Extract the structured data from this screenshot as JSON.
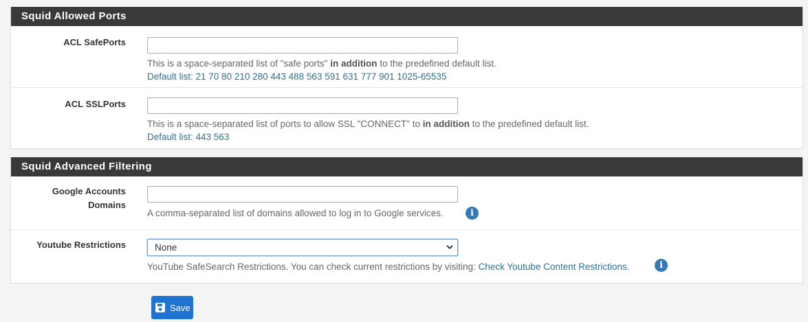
{
  "sections": {
    "allowed_ports": {
      "title": "Squid Allowed Ports",
      "safe_ports": {
        "label": "ACL SafePorts",
        "value": "",
        "help_pre": "This is a space-separated list of \"safe ports\" ",
        "help_bold": "in addition",
        "help_post": " to the predefined default list.",
        "default_list": "Default list: 21 70 80 210 280 443 488 563 591 631 777 901 1025-65535"
      },
      "ssl_ports": {
        "label": "ACL SSLPorts",
        "value": "",
        "help_pre": "This is a space-separated list of ports to allow SSL \"CONNECT\" to ",
        "help_bold": "in addition",
        "help_post": " to the predefined default list.",
        "default_list": "Default list: 443 563"
      }
    },
    "advanced_filtering": {
      "title": "Squid Advanced Filtering",
      "google_domains": {
        "label_line1": "Google Accounts",
        "label_line2": "Domains",
        "value": "",
        "help": "A comma-separated list of domains allowed to log in to Google services."
      },
      "youtube": {
        "label": "Youtube Restrictions",
        "selected": "None",
        "help": "YouTube SafeSearch Restrictions. You can check current restrictions by visiting: ",
        "help_link": "Check Youtube Content Restrictions",
        "help_end": "."
      }
    }
  },
  "save_button": {
    "label": "Save"
  },
  "icons": {
    "info": "info-circle-icon",
    "save": "floppy-disk-icon",
    "chevron": "chevron-down-icon"
  },
  "colors": {
    "panel_heading": "#393939",
    "link": "#30708f",
    "primary": "#1e74d0",
    "info": "#337ab7"
  }
}
